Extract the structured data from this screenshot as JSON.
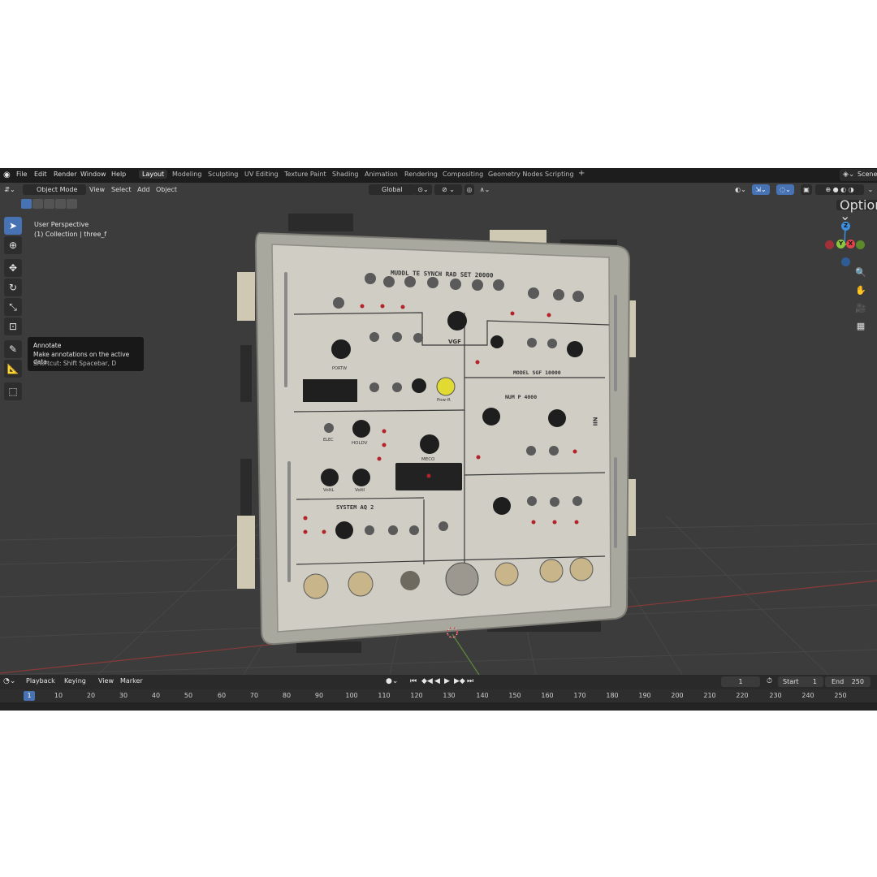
{
  "topbar": {
    "menu": [
      "File",
      "Edit",
      "Render",
      "Window",
      "Help"
    ],
    "workspaces": [
      "Layout",
      "Modeling",
      "Sculpting",
      "UV Editing",
      "Texture Paint",
      "Shading",
      "Animation",
      "Rendering",
      "Compositing",
      "Geometry Nodes",
      "Scripting"
    ],
    "active_workspace": "Layout",
    "add_tab": "+",
    "scene": "Scene"
  },
  "viewport_header": {
    "mode": "Object Mode",
    "menus": [
      "View",
      "Select",
      "Add",
      "Object"
    ],
    "transform_orientation": "Global",
    "options": "Options"
  },
  "viewport": {
    "view_name": "User Perspective",
    "collection": "(1) Collection | three_f"
  },
  "tooltip": {
    "title": "Annotate",
    "description": "Make annotations on the active data.",
    "shortcut": "Shortcut: Shift Spacebar, D"
  },
  "gizmo": {
    "z": "Z",
    "y": "Y",
    "x": "X",
    "colors": {
      "x": "#e0434c",
      "y": "#8cc63f",
      "z": "#3d8fe0"
    }
  },
  "panel": {
    "title": "MUDDL TE SYNCH RAD SET 20000",
    "vgf": "VGF",
    "model": "MODEL SGF 10000",
    "num": "NUM P 4000",
    "system": "SYSTEM AQ 2",
    "knob_labels": [
      "PORTW",
      "HOLDV",
      "ELEC",
      "VoltL",
      "VoltI",
      "MECO",
      "Pow-R"
    ],
    "side_label": "NII"
  },
  "timeline": {
    "menus": [
      "Playback",
      "Keying",
      "View",
      "Marker"
    ],
    "current_frame": "1",
    "start_label": "Start",
    "start": "1",
    "end_label": "End",
    "end": "250",
    "ruler": [
      "1",
      "10",
      "20",
      "30",
      "40",
      "50",
      "60",
      "70",
      "80",
      "90",
      "100",
      "110",
      "120",
      "130",
      "140",
      "150",
      "160",
      "170",
      "180",
      "190",
      "200",
      "210",
      "220",
      "230",
      "240",
      "250"
    ]
  },
  "colors": {
    "accent": "#4772b3",
    "viewport_bg": "#3c3c3c",
    "panel_face": "#c9c9bf"
  }
}
